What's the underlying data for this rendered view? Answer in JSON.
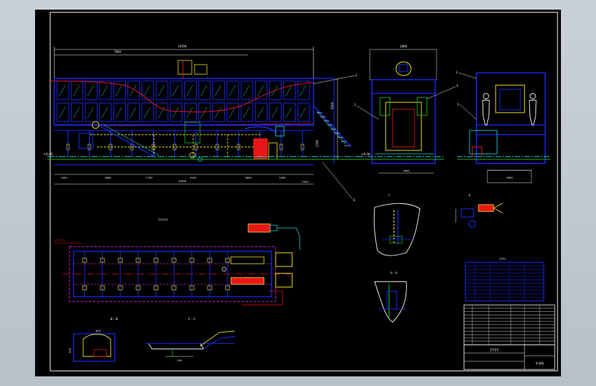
{
  "drawing": {
    "sheet_code": "Y-00",
    "title_block_name": "????",
    "table_title": "????",
    "plan_view_label": "??????",
    "plan_note": "???? ??",
    "section_labels": {
      "upper_detail": "I",
      "right_detail": "II",
      "lower_detail": "II - II",
      "b_section": "B - B",
      "c_section": "C - C"
    },
    "elevation_marks": {
      "left": "+0.00",
      "middle": "+0.00"
    },
    "dimensions": {
      "overall_top": "14500",
      "top_segment": "7800",
      "right_height": "4500",
      "stair_height": "3700",
      "bottom_1": "1400",
      "bottom_2": "3800",
      "bottom_3": "1700",
      "bottom_4": "4100",
      "bottom_5": "1800",
      "bottom_6": "2000",
      "bottom_total": "15800",
      "bottom_right": "4500",
      "end_view_top": "2800",
      "end_view_bottom": "1800",
      "side_view_bottom": "1800",
      "detail_b_width": "400",
      "detail_b_height": "200",
      "detail_c_width": "250"
    },
    "callouts": [
      "1",
      "2",
      "3",
      "4",
      "5",
      "6"
    ],
    "colors": {
      "frame_blue": "#1a2cff",
      "cyan": "#19d6e8",
      "yellow": "#f2e61a",
      "red": "#e81818",
      "green": "#19b51a",
      "white": "#ffffff",
      "magenta": "#d018d0"
    }
  }
}
